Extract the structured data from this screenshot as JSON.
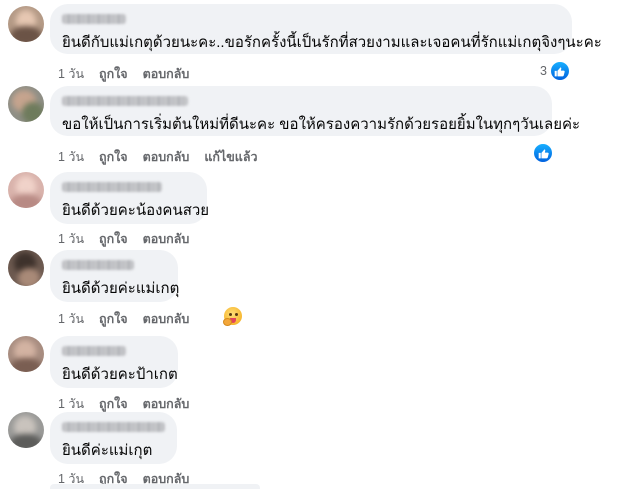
{
  "comments": [
    {
      "text": "ยินดีกับแม่เกตุด้วยนะคะ..ขอรักครั้งนี้เป็นรักที่สวยงามและเจอคนที่รักแม่เกตุจิงๆนะคะ",
      "time": "1 วัน",
      "like": "ถูกใจ",
      "reply": "ตอบกลับ",
      "reaction_count": "3",
      "reaction_icon": "like-icon"
    },
    {
      "text": "ขอให้เป็นการเริ่มต้นใหม่ที่ดีนะคะ ขอให้ครองความรักด้วยรอยยิ้มในทุกๆวันเลยค่ะ",
      "time": "1 วัน",
      "like": "ถูกใจ",
      "reply": "ตอบกลับ",
      "edited": "แก้ไขแล้ว",
      "reaction_icon": "like-icon"
    },
    {
      "text": "ยินดีด้วยคะน้องคนสวย",
      "time": "1 วัน",
      "like": "ถูกใจ",
      "reply": "ตอบกลับ"
    },
    {
      "text": "ยินดีด้วยค่ะแม่เกตุ",
      "time": "1 วัน",
      "like": "ถูกใจ",
      "reply": "ตอบกลับ",
      "reaction_icon": "care-emoji-icon"
    },
    {
      "text": "ยินดีด้วยคะป้าเกต",
      "time": "1 วัน",
      "like": "ถูกใจ",
      "reply": "ตอบกลับ"
    },
    {
      "text": "ยินดีค่ะแม่เกุต",
      "time": "1 วัน",
      "like": "ถูกใจ",
      "reply": "ตอบกลับ"
    }
  ],
  "colors": {
    "bubble": "#f0f2f5",
    "text": "#050505",
    "meta": "#65676b",
    "like_blue": "#0866ff"
  }
}
